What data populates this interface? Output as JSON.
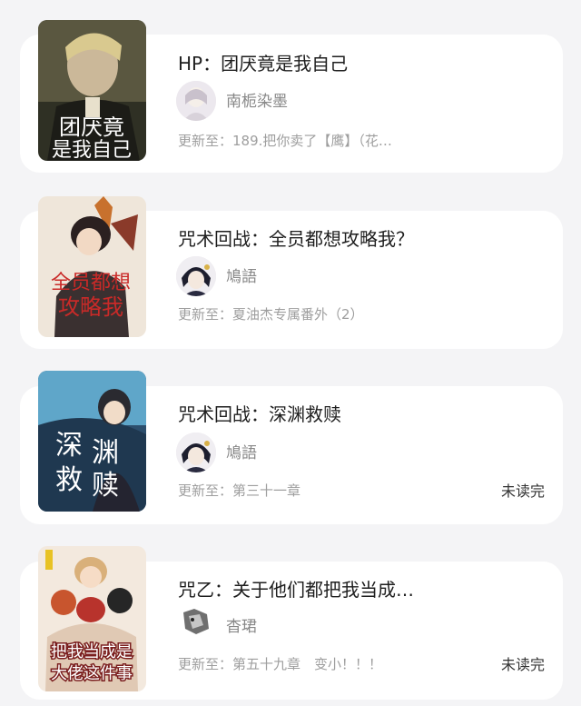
{
  "books": [
    {
      "title": "HP：团厌竟是我自己",
      "author": "南栀染墨",
      "update": "更新至：189.把你卖了【鹰】（花…",
      "status": "",
      "cover_icon": "book-cover-1",
      "cover_text": "团厌竟是我自己",
      "cover_color": "#2f3024"
    },
    {
      "title": "咒术回战：全员都想攻略我？",
      "author": "鳩語",
      "update": "更新至：夏油杰专属番外（2）",
      "status": "",
      "cover_icon": "book-cover-2",
      "cover_text": "全员都想攻略我",
      "cover_color": "#efe6da"
    },
    {
      "title": "咒术回战：深渊救赎",
      "author": "鳩語",
      "update": "更新至：第三十一章",
      "status": "未读完",
      "cover_icon": "book-cover-3",
      "cover_text": "深渊救赎",
      "cover_color": "#2c4e6c"
    },
    {
      "title": "咒乙：关于他们都把我当成…",
      "author": "杳珺",
      "update": "更新至：第五十九章　变小！！！",
      "status": "未读完",
      "cover_icon": "book-cover-4",
      "cover_text": "把我当成是大佬这件事",
      "cover_color": "#f3e9de"
    }
  ],
  "colors": {
    "background": "#f4f4f6",
    "card": "#ffffff",
    "title": "#1e1e1e",
    "meta": "#9e9e9e"
  }
}
